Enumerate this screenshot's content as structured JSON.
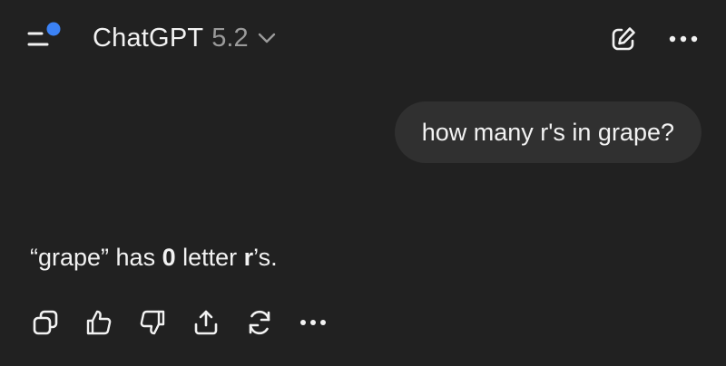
{
  "header": {
    "title": "ChatGPT",
    "version": "5.2",
    "menu_icon": "sidebar-menu-icon",
    "notification_dot_color": "#3b82f6",
    "new_chat_icon": "compose-icon",
    "more_icon": "ellipsis-icon"
  },
  "conversation": {
    "user_message": "how many r's in grape?",
    "assistant_message": {
      "part1": "“grape” has ",
      "count": "0",
      "part2": " letter ",
      "letter": "r",
      "part3": "’s."
    }
  },
  "actions": [
    {
      "icon": "copy-icon"
    },
    {
      "icon": "thumbs-up-icon"
    },
    {
      "icon": "thumbs-down-icon"
    },
    {
      "icon": "share-icon"
    },
    {
      "icon": "regenerate-icon"
    },
    {
      "icon": "ellipsis-icon"
    }
  ],
  "colors": {
    "background": "#212121",
    "bubble": "#303030",
    "text": "#f2f2f2",
    "muted": "#9b9b9b"
  }
}
